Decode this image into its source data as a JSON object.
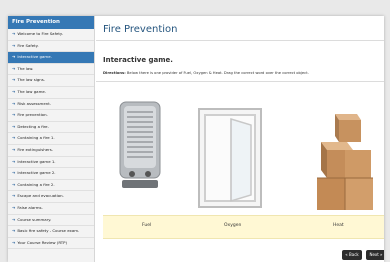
{
  "sidebar": {
    "header": "Fire Prevention",
    "items": [
      {
        "label": "Welcome to Fire Safety.",
        "active": false
      },
      {
        "label": "Fire Safety.",
        "active": false
      },
      {
        "label": "Interactive game.",
        "active": true
      },
      {
        "label": "The law.",
        "active": false
      },
      {
        "label": "The law signs.",
        "active": false
      },
      {
        "label": "The law game.",
        "active": false
      },
      {
        "label": "Risk assessment.",
        "active": false
      },
      {
        "label": "Fire prevention.",
        "active": false
      },
      {
        "label": "Detecting a fire.",
        "active": false
      },
      {
        "label": "Containing a fire 1.",
        "active": false
      },
      {
        "label": "Fire extinguishers.",
        "active": false
      },
      {
        "label": "Interactive game 1.",
        "active": false
      },
      {
        "label": "Interactive game 2.",
        "active": false
      },
      {
        "label": "Containing a fire 2.",
        "active": false
      },
      {
        "label": "Escape and evacuation.",
        "active": false
      },
      {
        "label": "False alarms.",
        "active": false
      },
      {
        "label": "Course summary.",
        "active": false
      },
      {
        "label": "Basic fire safety - Course exam.",
        "active": false
      },
      {
        "label": "Your Course Review (RTP)",
        "active": false
      }
    ]
  },
  "main": {
    "page_title": "Fire Prevention",
    "section_title": "Interactive game.",
    "directions_label": "Directions:",
    "directions_text": "Below there is one provider of Fuel, Oxygen & Heat. Drag the correct word over the correct object.",
    "drop_labels": {
      "fuel": "Fuel",
      "oxygen": "Oxygen",
      "heat": "Heat"
    },
    "back_label": "« Back",
    "next_label": "Next »"
  },
  "colors": {
    "accent": "#3578b5",
    "title": "#26567f",
    "drop_zone": "#fff8d4",
    "button": "#2c2c2c"
  }
}
